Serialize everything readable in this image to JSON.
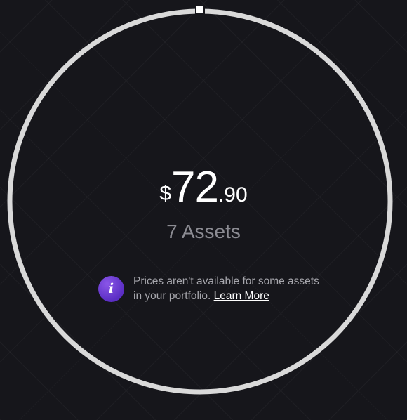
{
  "portfolio": {
    "currency_symbol": "$",
    "amount_whole": "72",
    "amount_cents": ".90",
    "assets_label": "7 Assets"
  },
  "notice": {
    "icon": "info-icon",
    "line1": "Prices aren't available for some assets",
    "line2": "in your portfolio.",
    "link_label": "Learn More"
  },
  "colors": {
    "background": "#16161b",
    "ring": "#d9d9d9",
    "text_primary": "#ffffff",
    "text_secondary": "#8c8c93",
    "accent": "#6a3ad6"
  }
}
